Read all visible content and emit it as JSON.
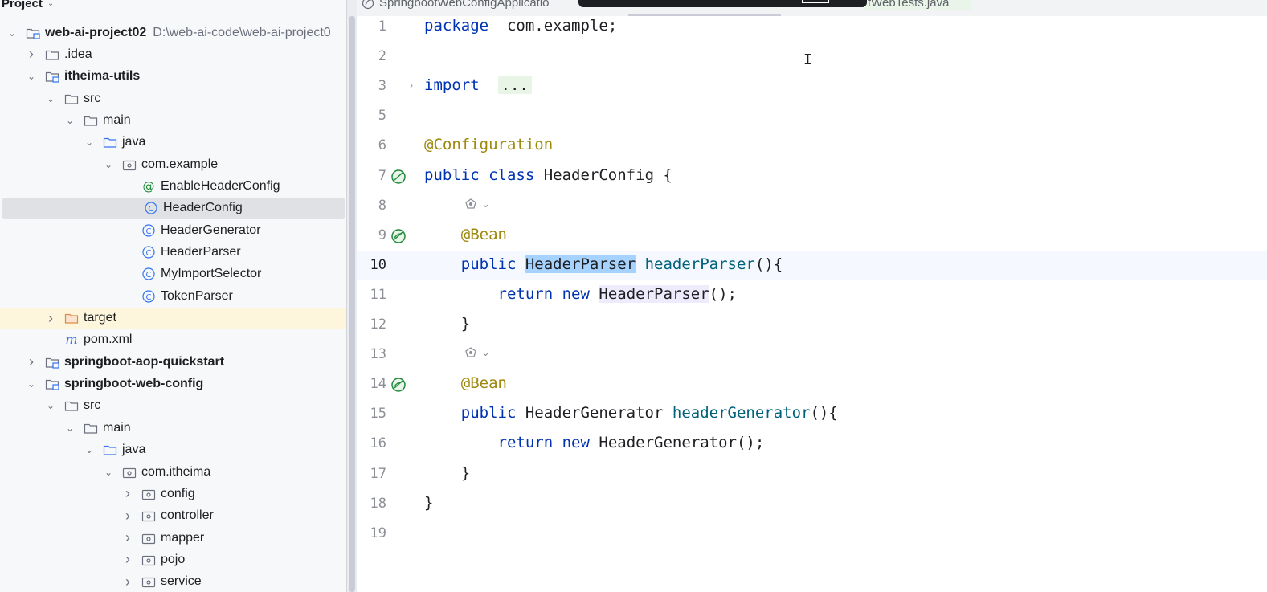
{
  "project_panel": {
    "title": "Project",
    "tree": [
      {
        "label": "web-ai-project02",
        "path": "D:\\web-ai-code\\web-ai-project0",
        "type": "module",
        "level": 0,
        "expanded": true,
        "bold": true
      },
      {
        "label": ".idea",
        "type": "folder",
        "level": 1,
        "expanded": false
      },
      {
        "label": "itheima-utils",
        "type": "module",
        "level": 1,
        "expanded": true,
        "bold": true
      },
      {
        "label": "src",
        "type": "folder",
        "level": 2,
        "expanded": true
      },
      {
        "label": "main",
        "type": "folder",
        "level": 3,
        "expanded": true
      },
      {
        "label": "java",
        "type": "source-folder",
        "level": 4,
        "expanded": true
      },
      {
        "label": "com.example",
        "type": "package",
        "level": 5,
        "expanded": true
      },
      {
        "label": "EnableHeaderConfig",
        "type": "annotation",
        "level": 6
      },
      {
        "label": "HeaderConfig",
        "type": "class",
        "level": 6,
        "selected": true
      },
      {
        "label": "HeaderGenerator",
        "type": "class",
        "level": 6
      },
      {
        "label": "HeaderParser",
        "type": "class",
        "level": 6
      },
      {
        "label": "MyImportSelector",
        "type": "class",
        "level": 6
      },
      {
        "label": "TokenParser",
        "type": "class",
        "level": 6
      },
      {
        "label": "target",
        "type": "excluded-folder",
        "level": 2,
        "expanded": false
      },
      {
        "label": "pom.xml",
        "type": "maven",
        "level": 2
      },
      {
        "label": "springboot-aop-quickstart",
        "type": "module",
        "level": 1,
        "expanded": false,
        "bold": true
      },
      {
        "label": "springboot-web-config",
        "type": "module",
        "level": 1,
        "expanded": true,
        "bold": true
      },
      {
        "label": "src",
        "type": "folder",
        "level": 2,
        "expanded": true
      },
      {
        "label": "main",
        "type": "folder",
        "level": 3,
        "expanded": true
      },
      {
        "label": "java",
        "type": "source-folder",
        "level": 4,
        "expanded": true
      },
      {
        "label": "com.itheima",
        "type": "package",
        "level": 5,
        "expanded": true
      },
      {
        "label": "config",
        "type": "package",
        "level": 6,
        "expanded": false
      },
      {
        "label": "controller",
        "type": "package",
        "level": 6,
        "expanded": false
      },
      {
        "label": "mapper",
        "type": "package",
        "level": 6,
        "expanded": false
      },
      {
        "label": "pojo",
        "type": "package",
        "level": 6,
        "expanded": false
      },
      {
        "label": "service",
        "type": "package",
        "level": 6,
        "expanded": false
      }
    ]
  },
  "tabs": {
    "left_label": "SpringbootWebConfigApplicatio",
    "right_label": "tWebTests.java"
  },
  "editor": {
    "lines": [
      {
        "n": "1",
        "tokens": [
          [
            "kw",
            "package"
          ],
          [
            "",
            "  com.example;"
          ]
        ]
      },
      {
        "n": "2",
        "tokens": []
      },
      {
        "n": "3",
        "tokens": [
          [
            "kw",
            "import"
          ],
          [
            "",
            "  "
          ],
          [
            "fold",
            "..."
          ]
        ],
        "fold": true
      },
      {
        "n": "5",
        "tokens": []
      },
      {
        "n": "6",
        "tokens": [
          [
            "ann",
            "@Configuration"
          ]
        ]
      },
      {
        "n": "7",
        "tokens": [
          [
            "kw",
            "public"
          ],
          [
            "",
            " "
          ],
          [
            "kw",
            "class"
          ],
          [
            "",
            " HeaderConfig {"
          ]
        ],
        "icon": "bean-config"
      },
      {
        "n": "8",
        "tokens": []
      },
      {
        "n": "9",
        "tokens": [
          [
            "",
            "    "
          ],
          [
            "ann",
            "@Bean"
          ]
        ],
        "icon": "bean",
        "inlay": true
      },
      {
        "n": "10",
        "tokens": [
          [
            "",
            "    "
          ],
          [
            "kw",
            "public"
          ],
          [
            "",
            " "
          ],
          [
            "sel",
            "HeaderParser"
          ],
          [
            "",
            " "
          ],
          [
            "fn",
            "headerParser"
          ],
          [
            "",
            "(){"
          ]
        ],
        "current": true
      },
      {
        "n": "11",
        "tokens": [
          [
            "",
            "        "
          ],
          [
            "kw",
            "return"
          ],
          [
            "",
            " "
          ],
          [
            "kw",
            "new"
          ],
          [
            "",
            " "
          ],
          [
            "ref",
            "HeaderParser"
          ],
          [
            "",
            "();"
          ]
        ]
      },
      {
        "n": "12",
        "tokens": [
          [
            "",
            "    }"
          ]
        ]
      },
      {
        "n": "13",
        "tokens": []
      },
      {
        "n": "14",
        "tokens": [
          [
            "",
            "    "
          ],
          [
            "ann",
            "@Bean"
          ]
        ],
        "icon": "bean",
        "inlay": true
      },
      {
        "n": "15",
        "tokens": [
          [
            "",
            "    "
          ],
          [
            "kw",
            "public"
          ],
          [
            "",
            " HeaderGenerator "
          ],
          [
            "fn",
            "headerGenerator"
          ],
          [
            "",
            "(){"
          ]
        ]
      },
      {
        "n": "16",
        "tokens": [
          [
            "",
            "        "
          ],
          [
            "kw",
            "return"
          ],
          [
            "",
            " "
          ],
          [
            "kw",
            "new"
          ],
          [
            "",
            " HeaderGenerator();"
          ]
        ]
      },
      {
        "n": "17",
        "tokens": [
          [
            "",
            "    }"
          ]
        ]
      },
      {
        "n": "18",
        "tokens": [
          [
            "",
            "}"
          ]
        ]
      },
      {
        "n": "19",
        "tokens": []
      }
    ]
  },
  "colors": {
    "keyword": "#0033b3",
    "annotation": "#9e880d",
    "method": "#00627a",
    "selection": "#a6d2ff",
    "selected_row": "#dfe1e5",
    "folder_icon": "#6c707e",
    "class_icon": "#3574f0",
    "bean_icon": "#208a3c"
  }
}
